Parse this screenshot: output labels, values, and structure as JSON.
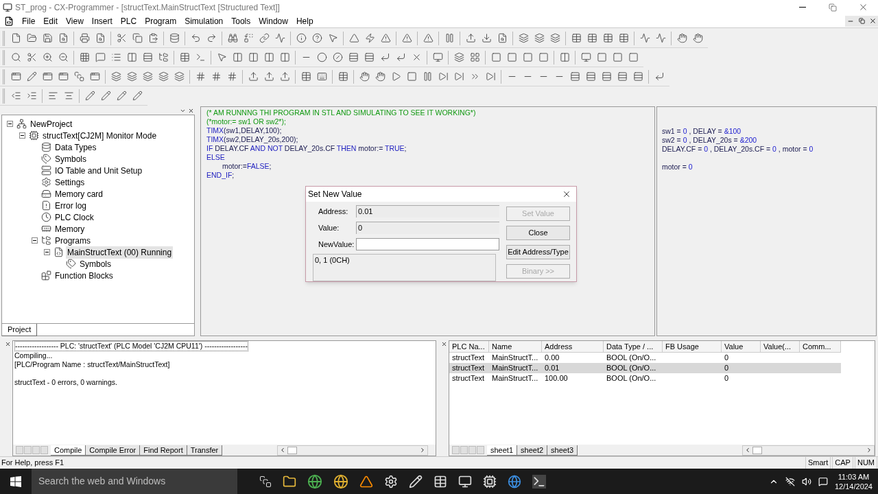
{
  "window": {
    "title": "ST_prog - CX-Programmer - [structText.MainStructText [Structured Text]]"
  },
  "menu": [
    "File",
    "Edit",
    "View",
    "Insert",
    "PLC",
    "Program",
    "Simulation",
    "Tools",
    "Window",
    "Help"
  ],
  "tree": [
    {
      "label": "NewProject",
      "kind": "project",
      "expanded": true,
      "selected": false,
      "children": [
        {
          "label": "structText[CJ2M] Monitor Mode",
          "kind": "plc",
          "expanded": true,
          "selected": false,
          "children": [
            {
              "label": "Data Types",
              "kind": "datatypes",
              "selected": false
            },
            {
              "label": "Symbols",
              "kind": "symbols",
              "selected": false
            },
            {
              "label": "IO Table and Unit Setup",
              "kind": "io",
              "selected": false
            },
            {
              "label": "Settings",
              "kind": "settings",
              "selected": false
            },
            {
              "label": "Memory card",
              "kind": "card",
              "selected": false
            },
            {
              "label": "Error log",
              "kind": "errorlog",
              "selected": false
            },
            {
              "label": "PLC Clock",
              "kind": "clock",
              "selected": false
            },
            {
              "label": "Memory",
              "kind": "memory",
              "selected": false
            },
            {
              "label": "Programs",
              "kind": "programs",
              "expanded": true,
              "selected": false,
              "children": [
                {
                  "label": "MainStructText (00) Running",
                  "kind": "program",
                  "expanded": true,
                  "selected": true,
                  "children": [
                    {
                      "label": "Symbols",
                      "kind": "symbols",
                      "selected": false
                    }
                  ]
                }
              ]
            },
            {
              "label": "Function Blocks",
              "kind": "blocks",
              "selected": false
            }
          ]
        }
      ]
    }
  ],
  "project_tab": {
    "label": "Project",
    "selected": true
  },
  "code_lines": [
    {
      "tokens": [
        {
          "kind": "comment",
          "text": "(* AM RUNNNG THI PROGRAM IN STL AND SIMULATING TO SEE IT WORKING*)"
        }
      ]
    },
    {
      "tokens": [
        {
          "kind": "comment",
          "text": "(*motor:= sw1 OR sw2*);"
        }
      ]
    },
    {
      "tokens": [
        {
          "kind": "keyword",
          "text": "TIMX"
        },
        {
          "kind": "text",
          "text": "(sw1,DELAY,100);"
        }
      ]
    },
    {
      "tokens": [
        {
          "kind": "keyword",
          "text": "TIMX"
        },
        {
          "kind": "text",
          "text": "(sw2,DELAY_20s,200);"
        }
      ]
    },
    {
      "tokens": [
        {
          "kind": "keyword",
          "text": "IF"
        },
        {
          "kind": "text",
          "text": " DELAY.CF "
        },
        {
          "kind": "keyword",
          "text": "AND NOT"
        },
        {
          "kind": "text",
          "text": " DELAY_20s.CF "
        },
        {
          "kind": "keyword",
          "text": "THEN"
        },
        {
          "kind": "text",
          "text": " motor:= "
        },
        {
          "kind": "keyword",
          "text": "TRUE"
        },
        {
          "kind": "text",
          "text": ";"
        }
      ]
    },
    {
      "tokens": [
        {
          "kind": "keyword",
          "text": "ELSE"
        }
      ]
    },
    {
      "indented": true,
      "tokens": [
        {
          "kind": "text",
          "text": "motor:="
        },
        {
          "kind": "keyword",
          "text": "FALSE"
        },
        {
          "kind": "text",
          "text": ";"
        }
      ]
    },
    {
      "tokens": [
        {
          "kind": "keyword",
          "text": "END_IF"
        },
        {
          "kind": "text",
          "text": ";"
        }
      ]
    }
  ],
  "monitor_lines": [
    {
      "tokens": [
        {
          "kind": "text",
          "text": "sw1 = "
        },
        {
          "kind": "value",
          "text": "0"
        },
        {
          "kind": "text",
          "text": " , DELAY = "
        },
        {
          "kind": "value",
          "text": "&100"
        }
      ]
    },
    {
      "tokens": [
        {
          "kind": "text",
          "text": "sw2 = "
        },
        {
          "kind": "value",
          "text": "0"
        },
        {
          "kind": "text",
          "text": " , DELAY_20s = "
        },
        {
          "kind": "value",
          "text": "&200"
        }
      ]
    },
    {
      "tokens": [
        {
          "kind": "text",
          "text": "DELAY.CF = "
        },
        {
          "kind": "value",
          "text": "0"
        },
        {
          "kind": "text",
          "text": " , DELAY_20s.CF = "
        },
        {
          "kind": "value",
          "text": "0"
        },
        {
          "kind": "text",
          "text": " , motor = "
        },
        {
          "kind": "value",
          "text": "0"
        }
      ]
    },
    {
      "gap_before": true,
      "tokens": [
        {
          "kind": "text",
          "text": "motor = "
        },
        {
          "kind": "value",
          "text": "0"
        }
      ]
    }
  ],
  "dialog": {
    "title": "Set New Value",
    "fields": [
      {
        "label": "Address:",
        "value": "0.01",
        "kind": "readonly"
      },
      {
        "label": "Value:",
        "value": "0",
        "kind": "readonly"
      },
      {
        "label": "NewValue:",
        "kind": "input"
      }
    ],
    "info": "0, 1 (0CH)",
    "buttons": [
      {
        "label": "Set Value",
        "disabled": true
      },
      {
        "label": "Close",
        "disabled": false
      },
      {
        "label": "Edit Address/Type",
        "disabled": false
      },
      {
        "label": "Binary >>",
        "disabled": true
      }
    ]
  },
  "output": {
    "header": "------------------ PLC: 'structText' (PLC Model 'CJ2M CPU11') ------------------",
    "lines": [
      {
        "text": "Compiling..."
      },
      {
        "text": "[PLC/Program Name : structText/MainStructText]"
      },
      {
        "text": "structText - 0 errors, 0 warnings.",
        "gap_before": true
      }
    ],
    "tabs": [
      {
        "label": "Compile",
        "selected": true
      },
      {
        "label": "Compile Error",
        "selected": false
      },
      {
        "label": "Find Report",
        "selected": false
      },
      {
        "label": "Transfer",
        "selected": false
      }
    ]
  },
  "watch": {
    "columns": [
      "PLC Na...",
      "Name",
      "Address",
      "Data Type / ...",
      "FB Usage",
      "Value",
      "Value(...",
      "Comm..."
    ],
    "rows": [
      {
        "plc_name": "structText",
        "name": "MainStructT...",
        "address": "0.00",
        "data_type": "BOOL (On/O...",
        "value": "0",
        "selected": false
      },
      {
        "plc_name": "structText",
        "name": "MainStructT...",
        "address": "0.01",
        "data_type": "BOOL (On/O...",
        "value": "0",
        "selected": true
      },
      {
        "plc_name": "structText",
        "name": "MainStructT...",
        "address": "100.00",
        "data_type": "BOOL (On/O...",
        "value": "0",
        "selected": false
      }
    ],
    "tabs": [
      {
        "label": "sheet1",
        "selected": true
      },
      {
        "label": "sheet2",
        "selected": false
      },
      {
        "label": "sheet3",
        "selected": false
      }
    ]
  },
  "status_bar": {
    "help": "For Help, press F1",
    "indicators": [
      "Smart",
      "CAP",
      "NUM"
    ]
  },
  "taskbar": {
    "search_placeholder": "Search the web and Windows",
    "time": "11:03 AM",
    "date": "12/14/2024"
  }
}
